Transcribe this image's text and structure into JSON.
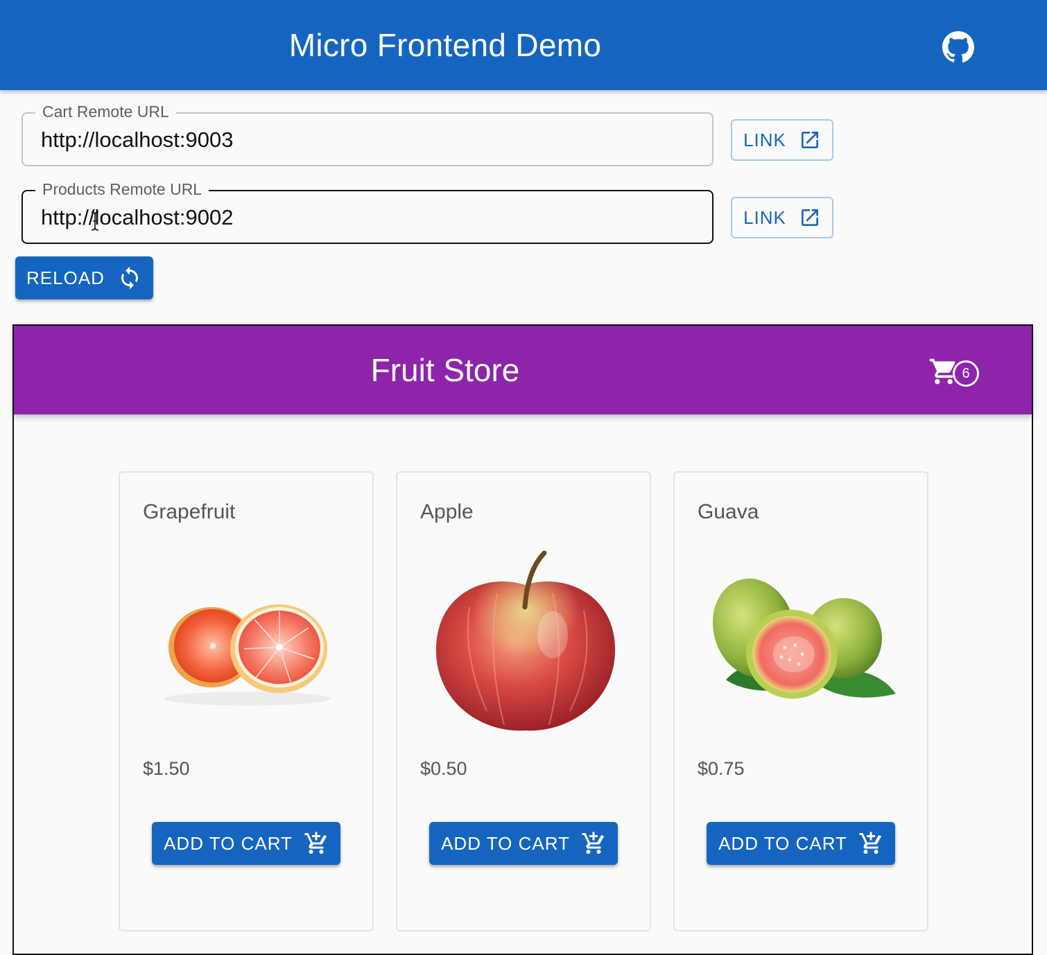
{
  "app": {
    "title": "Micro Frontend Demo",
    "github_icon": "github-icon",
    "accent_color": "#1565c0"
  },
  "remotes": {
    "cart": {
      "label": "Cart Remote URL",
      "value": "http://localhost:9003",
      "link_label": "LINK",
      "link_icon": "open-in-new-icon"
    },
    "products": {
      "label": "Products Remote URL",
      "value": "http://localhost:9002",
      "link_label": "LINK",
      "link_icon": "open-in-new-icon"
    }
  },
  "reload": {
    "label": "RELOAD",
    "icon": "sync-icon"
  },
  "store": {
    "title": "Fruit Store",
    "bar_color": "#8e24aa",
    "cart_icon": "shopping-cart-icon",
    "cart_count": "6",
    "products": [
      {
        "name": "Grapefruit",
        "price": "$1.50",
        "button_label": "ADD TO CART",
        "image": "grapefruit"
      },
      {
        "name": "Apple",
        "price": "$0.50",
        "button_label": "ADD TO CART",
        "image": "apple"
      },
      {
        "name": "Guava",
        "price": "$0.75",
        "button_label": "ADD TO CART",
        "image": "guava"
      }
    ],
    "add_icon": "add-shopping-cart-icon"
  }
}
